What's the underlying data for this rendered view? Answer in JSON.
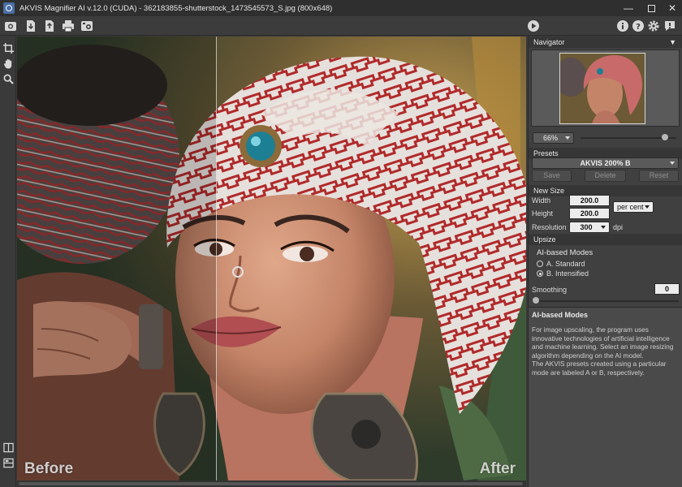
{
  "window": {
    "title": "AKVIS Magnifier AI v.12.0 (CUDA) - 362183855-shutterstock_1473545573_S.jpg (800x648)"
  },
  "toolbar": {
    "left_icons": [
      "open-icon",
      "save-icon",
      "export-icon",
      "print-icon",
      "batch-icon"
    ],
    "right_icons": [
      "run-icon",
      "info-icon",
      "help-icon",
      "settings-icon",
      "notification-icon"
    ]
  },
  "tools": [
    "crop-icon",
    "hand-icon",
    "zoom-icon",
    "before-after-single-icon",
    "before-after-split-icon"
  ],
  "canvas": {
    "before_label": "Before",
    "after_label": "After"
  },
  "navigator": {
    "title": "Navigator",
    "zoom": "66%",
    "zoom_fraction": 0.88
  },
  "presets": {
    "title": "Presets",
    "selected": "AKVIS 200% B",
    "save_label": "Save",
    "delete_label": "Delete",
    "reset_label": "Reset"
  },
  "new_size": {
    "title": "New Size",
    "width_label": "Width",
    "width_value": "200.0",
    "height_label": "Height",
    "height_value": "200.0",
    "unit": "per cent",
    "resolution_label": "Resolution",
    "resolution_value": "300",
    "resolution_unit": "dpi"
  },
  "upsize": {
    "title": "Upsize",
    "modes_label": "AI-based Modes",
    "mode_a": "A. Standard",
    "mode_b": "B. Intensified",
    "selected_mode": "B",
    "smoothing_label": "Smoothing",
    "smoothing_value": "0"
  },
  "help": {
    "title": "AI-based Modes",
    "paragraph1": "For image upscaling, the program uses innovative technologies of artificial intelligence and machine learning. Select an image resizing algorithm depending on the AI model.",
    "paragraph2": "The AKVIS presets created using a particular mode are labeled A or B, respectively."
  }
}
